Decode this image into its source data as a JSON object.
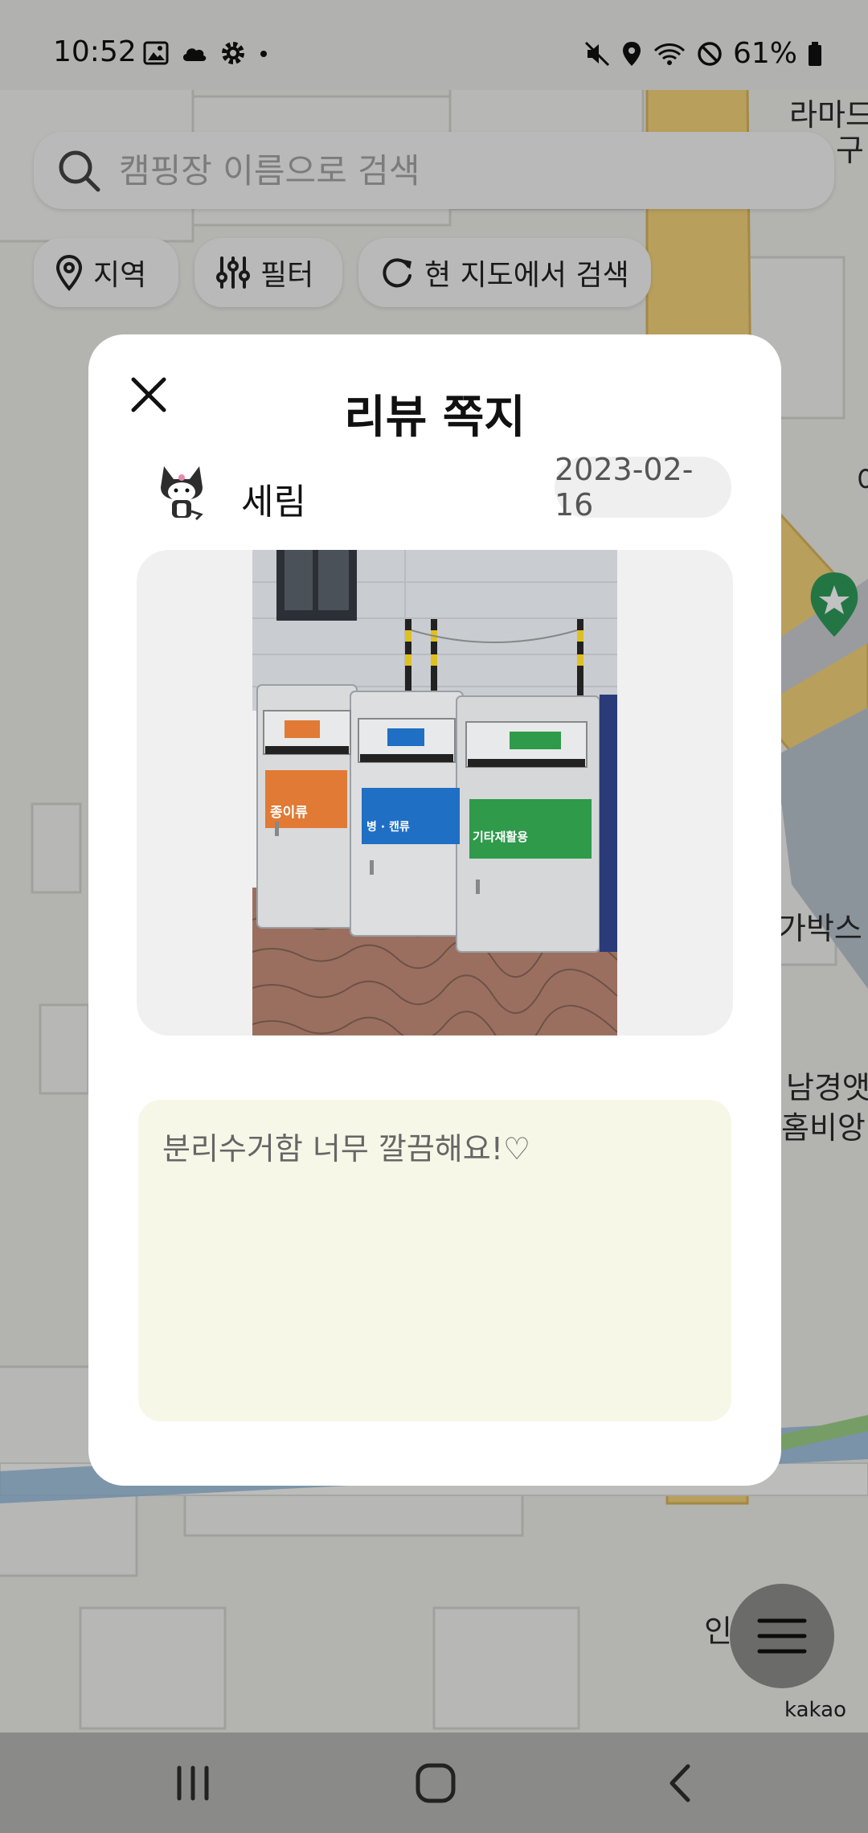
{
  "status_bar": {
    "time": "10:52",
    "battery": "61%",
    "left_icons": [
      "image-icon",
      "cloud-icon",
      "settings-icon",
      "dot-icon"
    ],
    "right_icons": [
      "mute-icon",
      "location-icon",
      "wifi-icon",
      "do-not-disturb-icon",
      "battery-icon"
    ]
  },
  "search": {
    "placeholder": "캠핑장 이름으로 검색"
  },
  "chips": {
    "region": "지역",
    "filter": "필터",
    "search_here": "현 지도에서 검색"
  },
  "map": {
    "labels": [
      "라마드",
      "구",
      "가박스",
      "남경앳",
      "홈비앙",
      "인",
      "야"
    ],
    "attribution": "kakao"
  },
  "modal": {
    "title": "리뷰 쪽지",
    "user_name": "세림",
    "date": "2023-02-16",
    "review_text": "분리수거함 너무 깔끔해요!♡",
    "photo_bins": [
      "종이류",
      "병 · 캔류",
      "기타재활용"
    ]
  },
  "colors": {
    "review_box": "#f7f7e8",
    "map_yellow": "#f3d27a",
    "marker_green": "#2e9b5a"
  }
}
